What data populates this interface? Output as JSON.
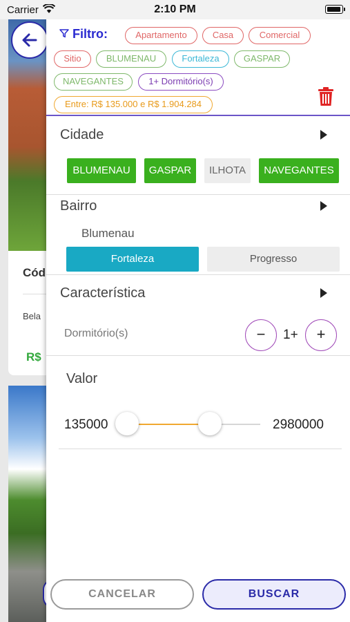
{
  "status_bar": {
    "carrier": "Carrier",
    "time": "2:10 PM"
  },
  "background_listing": {
    "code_partial": "Cód",
    "desc_partial": "Bela",
    "price_partial": "R$"
  },
  "filter": {
    "title": "Filtro:",
    "chips": [
      "Apartamento",
      "Casa",
      "Comercial",
      "Sitio",
      "BLUMENAU",
      "Fortaleza",
      "GASPAR",
      "NAVEGANTES",
      "1+ Dormitório(s)",
      "Entre: R$ 135.000 e R$ 1.904.284"
    ]
  },
  "cidade": {
    "title": "Cidade",
    "options": [
      {
        "label": "BLUMENAU",
        "selected": true
      },
      {
        "label": "GASPAR",
        "selected": true
      },
      {
        "label": "ILHOTA",
        "selected": false
      },
      {
        "label": "NAVEGANTES",
        "selected": true
      }
    ]
  },
  "bairro": {
    "title": "Bairro",
    "city_label": "Blumenau",
    "options": [
      {
        "label": "Fortaleza",
        "selected": true
      },
      {
        "label": "Progresso",
        "selected": false
      }
    ]
  },
  "caracteristica": {
    "title": "Característica",
    "dormitorio_label": "Dormitório(s)",
    "dormitorio_value": "1+",
    "minus_symbol": "−",
    "plus_symbol": "+"
  },
  "valor": {
    "title": "Valor",
    "min_label": "135000",
    "max_label": "2980000",
    "range_fraction": {
      "low": 0.0,
      "high": 0.62
    }
  },
  "footer": {
    "cancel_label": "CANCELAR",
    "search_label": "BUSCAR"
  },
  "colors": {
    "accent": "#2a2aa8",
    "selected_city": "#3ab01e",
    "selected_bairro": "#19a9c4",
    "slider_fill": "#f0a830",
    "trash": "#e02424"
  }
}
